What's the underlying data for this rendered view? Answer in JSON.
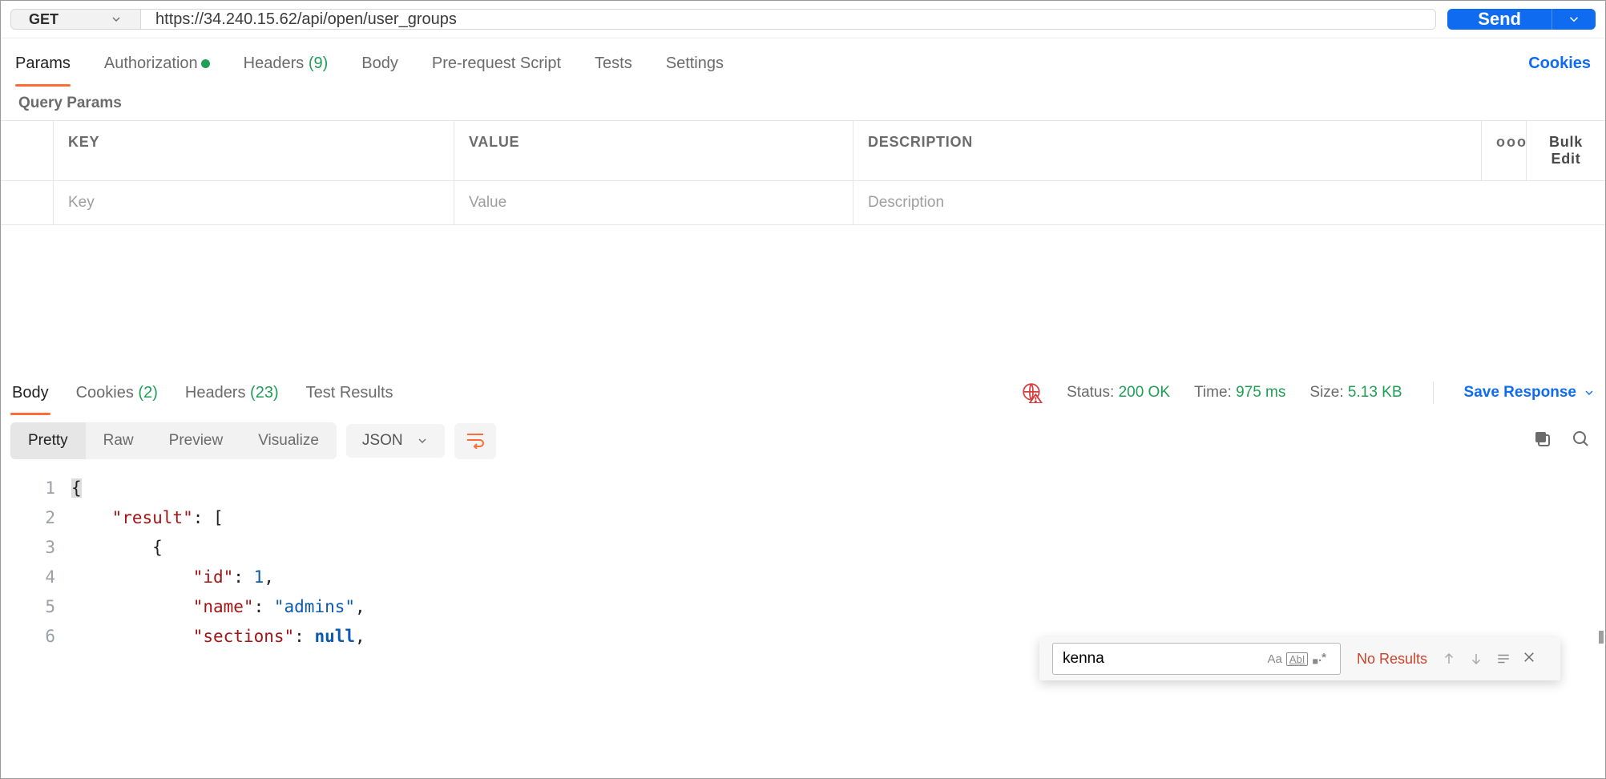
{
  "request": {
    "method": "GET",
    "url": "https://34.240.15.62/api/open/user_groups",
    "send_label": "Send"
  },
  "req_tabs": {
    "params": "Params",
    "authorization": "Authorization",
    "headers": "Headers",
    "headers_count": "(9)",
    "body": "Body",
    "prerequest": "Pre-request Script",
    "tests": "Tests",
    "settings": "Settings",
    "cookies_link": "Cookies"
  },
  "query_params": {
    "title": "Query Params",
    "headers": {
      "key": "KEY",
      "value": "VALUE",
      "description": "DESCRIPTION"
    },
    "placeholders": {
      "key": "Key",
      "value": "Value",
      "description": "Description"
    },
    "bulk_edit": "Bulk Edit",
    "more": "ooo"
  },
  "resp_tabs": {
    "body": "Body",
    "cookies": "Cookies",
    "cookies_count": "(2)",
    "headers": "Headers",
    "headers_count": "(23)",
    "test_results": "Test Results"
  },
  "status": {
    "label": "Status:",
    "value": "200 OK",
    "time_label": "Time:",
    "time_value": "975 ms",
    "size_label": "Size:",
    "size_value": "5.13 KB",
    "save_response": "Save Response"
  },
  "view": {
    "pretty": "Pretty",
    "raw": "Raw",
    "preview": "Preview",
    "visualize": "Visualize",
    "format": "JSON"
  },
  "code_lines": [
    "1",
    "2",
    "3",
    "4",
    "5",
    "6"
  ],
  "json_body": {
    "result_key": "\"result\"",
    "id_key": "\"id\"",
    "id_val": "1",
    "name_key": "\"name\"",
    "name_val": "\"admins\"",
    "sections_key": "\"sections\"",
    "sections_val": "null"
  },
  "find": {
    "value": "kenna",
    "no_results": "No Results",
    "aa": "Aa",
    "abi": "AbI",
    "regex": ".*"
  }
}
